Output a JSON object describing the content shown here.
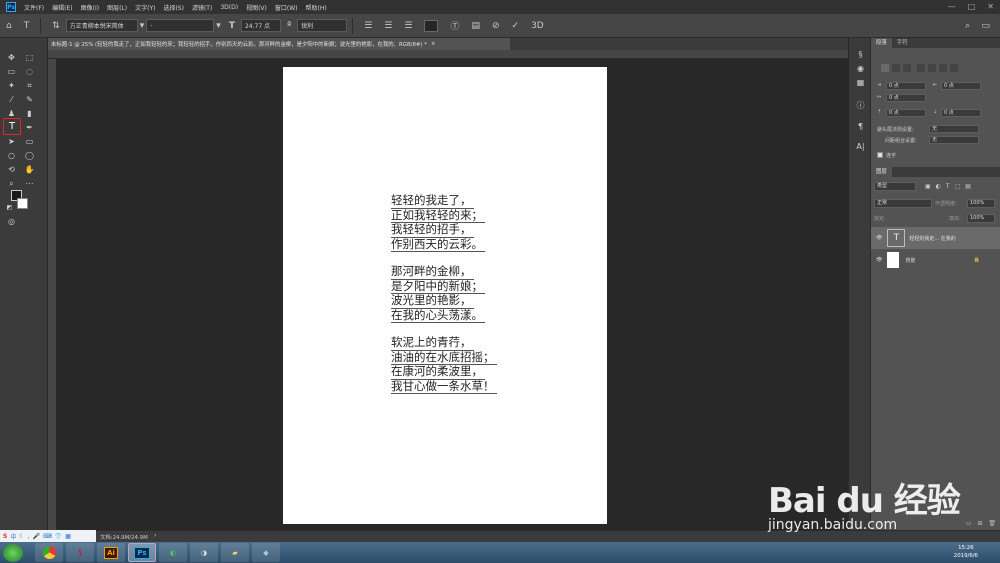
{
  "app": {
    "logo": "Ps"
  },
  "menubar": {
    "items": [
      "文件(F)",
      "编辑(E)",
      "图像(I)",
      "图层(L)",
      "文字(Y)",
      "选择(S)",
      "滤镜(T)",
      "3D(D)",
      "视图(V)",
      "窗口(W)",
      "帮助(H)"
    ],
    "window_controls": [
      "—",
      "□",
      "✕"
    ]
  },
  "options": {
    "font_family": "方正青柳本悦宋简体",
    "font_style": "-",
    "font_size": "24.77 点",
    "antialias": "锐利",
    "icons": [
      "home-icon",
      "text-tool-icon",
      "orientation-icon",
      "align-left-icon",
      "align-center-icon",
      "align-right-icon",
      "color-swatch",
      "warp-text-icon",
      "panels-icon",
      "cancel-icon",
      "commit-icon",
      "3d-icon"
    ]
  },
  "doc_tab": {
    "title": "未标题-1 @ 25% (轻轻的我走了，正如我轻轻的来；我轻轻的招手，作别西天的云彩。那河畔的金柳，是夕阳中的新娘；波光里的艳影，在我的、RGB/8#) *",
    "close": "×"
  },
  "poem": {
    "stanzas": [
      [
        "轻轻的我走了，",
        "正如我轻轻的来；",
        "我轻轻的招手，",
        "作别西天的云彩。"
      ],
      [
        "那河畔的金柳，",
        "是夕阳中的新娘；",
        "波光里的艳影，",
        "在我的心头荡漾。"
      ],
      [
        "软泥上的青荇，",
        "油油的在水底招摇；",
        "在康河的柔波里，",
        "我甘心做一条水草！"
      ]
    ]
  },
  "paragraph_panel": {
    "tabs": [
      "段落",
      "字符"
    ],
    "indent_left": "0 点",
    "indent_right": "0 点",
    "indent_first": "0 点",
    "space_before": "0 点",
    "space_after": "0 点",
    "avoid_label": "避头尾法则设置:",
    "avoid_value": "无",
    "spacing_label": "间距组合设置:",
    "spacing_value": "无",
    "hyphenate_label": "连字"
  },
  "layers_panel": {
    "tab": "图层",
    "search_placeholder": "类型",
    "blend_mode": "正常",
    "opacity_label": "不透明度:",
    "opacity_value": "100%",
    "lock_label": "锁定:",
    "fill_label": "填充:",
    "fill_value": "100%",
    "layers": [
      {
        "name": "轻轻的我走... 在我的",
        "type": "text"
      },
      {
        "name": "背景",
        "type": "background"
      }
    ]
  },
  "statusbar": {
    "zoom": "25%",
    "doc_info": "文档:24.9M/24.9M"
  },
  "taskbar": {
    "apps": [
      "chrome-icon",
      "acrobat-icon",
      "illustrator-icon",
      "photoshop-icon",
      "app-icon",
      "app-icon",
      "folder-icon",
      "app-icon"
    ],
    "illustrator_label": "Ai",
    "photoshop_label": "Ps",
    "time": "15:26",
    "date": "2019/6/6"
  },
  "watermark": {
    "brand": "Bai du 经验",
    "url": "jingyan.baidu.com"
  }
}
